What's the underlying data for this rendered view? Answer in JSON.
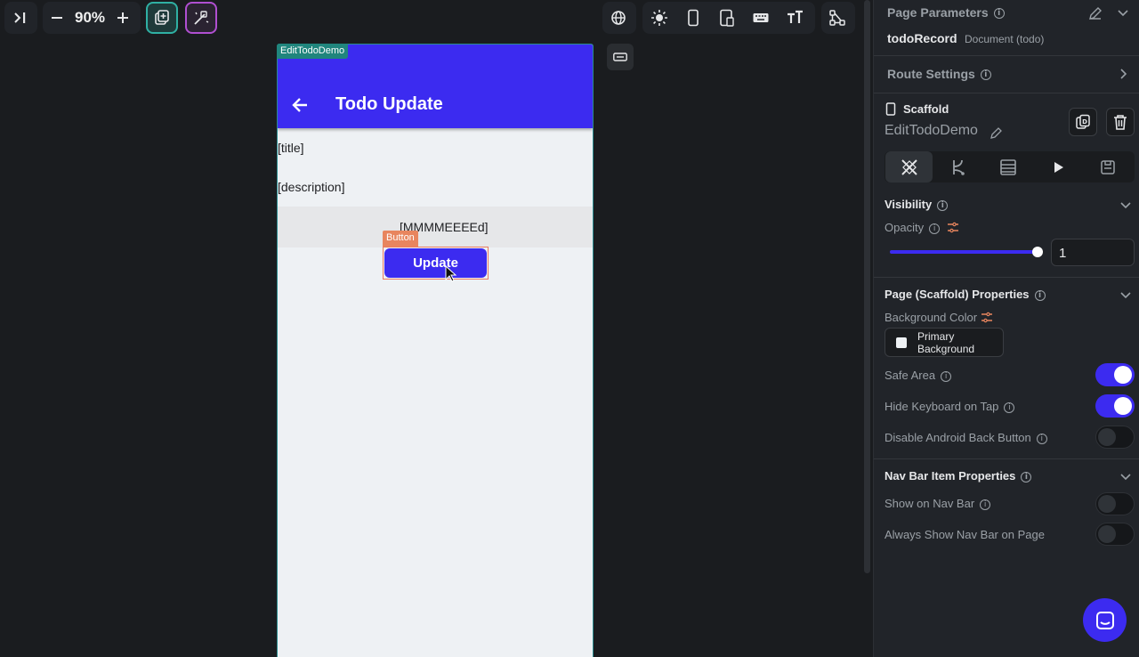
{
  "toolbar": {
    "zoom": "90%",
    "icons": [
      "collapse-panel-icon",
      "zoom-out-icon",
      "zoom-in-icon",
      "add-page-icon",
      "magic-edit-icon",
      "globe-icon",
      "sun-icon",
      "phone-icon",
      "tablet-icon",
      "keyboard-icon",
      "text-size-icon",
      "tree-icon"
    ]
  },
  "canvas": {
    "page_tag": "EditTodoDemo",
    "appbar_title": "Todo Update",
    "title_text": "[title]",
    "description_text": "[description]",
    "date_text": "[MMMMEEEEd]",
    "button_tag": "Button",
    "button_label": "Update"
  },
  "panel": {
    "page_parameters": {
      "title": "Page Parameters",
      "param_name": "todoRecord",
      "param_type": "Document (todo)"
    },
    "route_settings": "Route Settings",
    "widget": {
      "type": "Scaffold",
      "name": "EditTodoDemo"
    },
    "visibility": {
      "title": "Visibility",
      "opacity_label": "Opacity",
      "opacity_value": "1",
      "opacity_fraction": 1.0
    },
    "page_props": {
      "title": "Page (Scaffold) Properties",
      "bg_color_label": "Background Color",
      "bg_color_value": "Primary Background",
      "safe_area": "Safe Area",
      "safe_area_on": true,
      "hide_keyboard": "Hide Keyboard on Tap",
      "hide_keyboard_on": true,
      "disable_back": "Disable Android Back Button",
      "disable_back_on": false
    },
    "nav_bar": {
      "title": "Nav Bar Item Properties",
      "show_on_nav": "Show on Nav Bar",
      "show_on_nav_on": false,
      "always_show": "Always Show Nav Bar on Page",
      "always_show_on": false
    }
  },
  "colors": {
    "accent": "#3c2bf0",
    "canvas_bg": "#1a1c1f",
    "panel_bg": "#212429",
    "page_tag": "#20857d",
    "button_tag": "#e8855e"
  }
}
